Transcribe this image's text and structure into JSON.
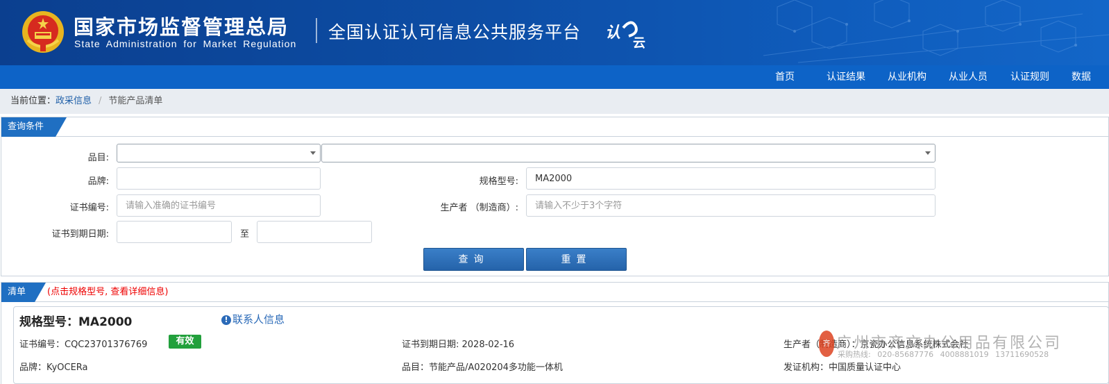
{
  "header": {
    "title_cn": "国家市场监督管理总局",
    "title_en": "State Administration  for  Market Regulation",
    "platform": "全国认证认可信息公共服务平台",
    "logo_text": "认",
    "logo_text2": "云"
  },
  "nav": {
    "items": [
      "首页",
      "认证结果",
      "从业机构",
      "从业人员",
      "认证规则",
      "数据"
    ]
  },
  "breadcrumb": {
    "label": "当前位置：",
    "link": "政采信息",
    "sep": "/",
    "current": "节能产品清单"
  },
  "query": {
    "title": "查询条件",
    "category_label": "品目:",
    "brand_label": "品牌:",
    "brand_value": "",
    "model_label": "规格型号:",
    "model_value": "MA2000",
    "cert_no_label": "证书编号:",
    "cert_no_placeholder": "请输入准确的证书编号",
    "maker_label": "生产者 （制造商）:",
    "maker_placeholder": "请输入不少于3个字符",
    "expiry_label": "证书到期日期:",
    "to_label": "至",
    "search_button": "查询",
    "reset_button": "重置"
  },
  "list": {
    "title": "清单",
    "note": "(点击规格型号, 查看详细信息)",
    "card": {
      "model": "规格型号：MA2000",
      "contact": "联系人信息",
      "cert_no": "证书编号：CQC23701376769",
      "status": "有效",
      "expiry": "证书到期日期: 2028-02-16",
      "maker": "生产者（制造商）：京瓷办公信息系统株式会社",
      "brand": "品牌：KyOCERa",
      "category": "品目：节能产品/A020204多功能一体机",
      "issuer": "发证机构：中国质量认证中心"
    },
    "watermark": {
      "seal": "齐",
      "name": "广州市齐文办公用品有限公司",
      "tel": "采购热线: 020-85687776   4008881019   13711690528"
    }
  },
  "colors": {
    "header": "#0d4ea6",
    "nav": "#0d63c7",
    "tab": "#1f6fc2",
    "badge": "#22a03c",
    "note": "#e00000"
  }
}
